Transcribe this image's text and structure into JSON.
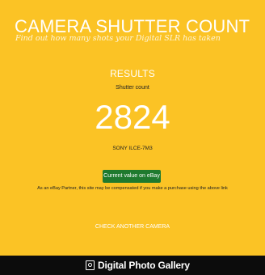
{
  "header": {
    "title": "CAMERA SHUTTER COUNT",
    "subtitle": "Find out how many shots your Digital SLR has taken"
  },
  "results": {
    "heading": "RESULTS",
    "count_label": "Shutter count",
    "count_value": "2824",
    "camera_model": "SONY ILCE-7M3",
    "ebay_button_label": "Current value on eBay",
    "disclaimer": "As an eBay Partner, this site may be compensated if you make a purchase using the above link",
    "check_another_label": "CHECK ANOTHER CAMERA"
  },
  "footer": {
    "brand": "Digital Photo Gallery",
    "brand_icon": "dpg-logo-icon"
  },
  "colors": {
    "background": "#fbc325",
    "button": "#1f7a2e",
    "footer": "#0c0c0c",
    "text_light": "#ffffff",
    "text_dark": "#222222"
  }
}
